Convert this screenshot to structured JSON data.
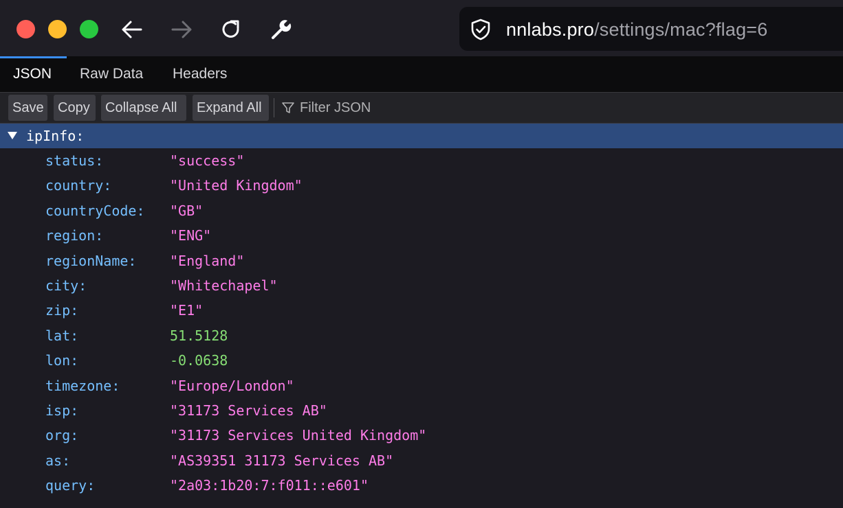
{
  "window": {
    "traffic_lights": [
      "close",
      "minimize",
      "zoom"
    ]
  },
  "nav": {
    "back_icon": "arrow-left-icon",
    "forward_icon": "arrow-right-icon",
    "reload_icon": "reload-icon",
    "tools_icon": "wrench-icon"
  },
  "urlbar": {
    "host": "nnlabs.pro",
    "path": "/settings/mac?flag=6",
    "icon": "shield-icon"
  },
  "tabs": [
    {
      "label": "JSON",
      "active": true
    },
    {
      "label": "Raw Data",
      "active": false
    },
    {
      "label": "Headers",
      "active": false
    }
  ],
  "actions": {
    "save": "Save",
    "copy": "Copy",
    "collapse_all": "Collapse All",
    "expand_all": "Expand All",
    "filter_placeholder": "Filter JSON",
    "filter_icon": "funnel-icon"
  },
  "json": {
    "root_key": "ipInfo:",
    "rows": [
      {
        "key": "status:",
        "value": "\"success\"",
        "type": "string"
      },
      {
        "key": "country:",
        "value": "\"United Kingdom\"",
        "type": "string"
      },
      {
        "key": "countryCode:",
        "value": "\"GB\"",
        "type": "string"
      },
      {
        "key": "region:",
        "value": "\"ENG\"",
        "type": "string"
      },
      {
        "key": "regionName:",
        "value": "\"England\"",
        "type": "string"
      },
      {
        "key": "city:",
        "value": "\"Whitechapel\"",
        "type": "string"
      },
      {
        "key": "zip:",
        "value": "\"E1\"",
        "type": "string"
      },
      {
        "key": "lat:",
        "value": "51.5128",
        "type": "number"
      },
      {
        "key": "lon:",
        "value": "-0.0638",
        "type": "number"
      },
      {
        "key": "timezone:",
        "value": "\"Europe/London\"",
        "type": "string"
      },
      {
        "key": "isp:",
        "value": "\"31173 Services AB\"",
        "type": "string"
      },
      {
        "key": "org:",
        "value": "\"31173 Services United Kingdom\"",
        "type": "string"
      },
      {
        "key": "as:",
        "value": "\"AS39351 31173 Services AB\"",
        "type": "string"
      },
      {
        "key": "query:",
        "value": "\"2a03:1b20:7:f011::e601\"",
        "type": "string"
      }
    ]
  },
  "colors": {
    "key": "#75bfff",
    "string": "#ff7de9",
    "number": "#86de74",
    "selected_row": "#2d4b7e",
    "tab_indicator": "#3a8ef6"
  }
}
